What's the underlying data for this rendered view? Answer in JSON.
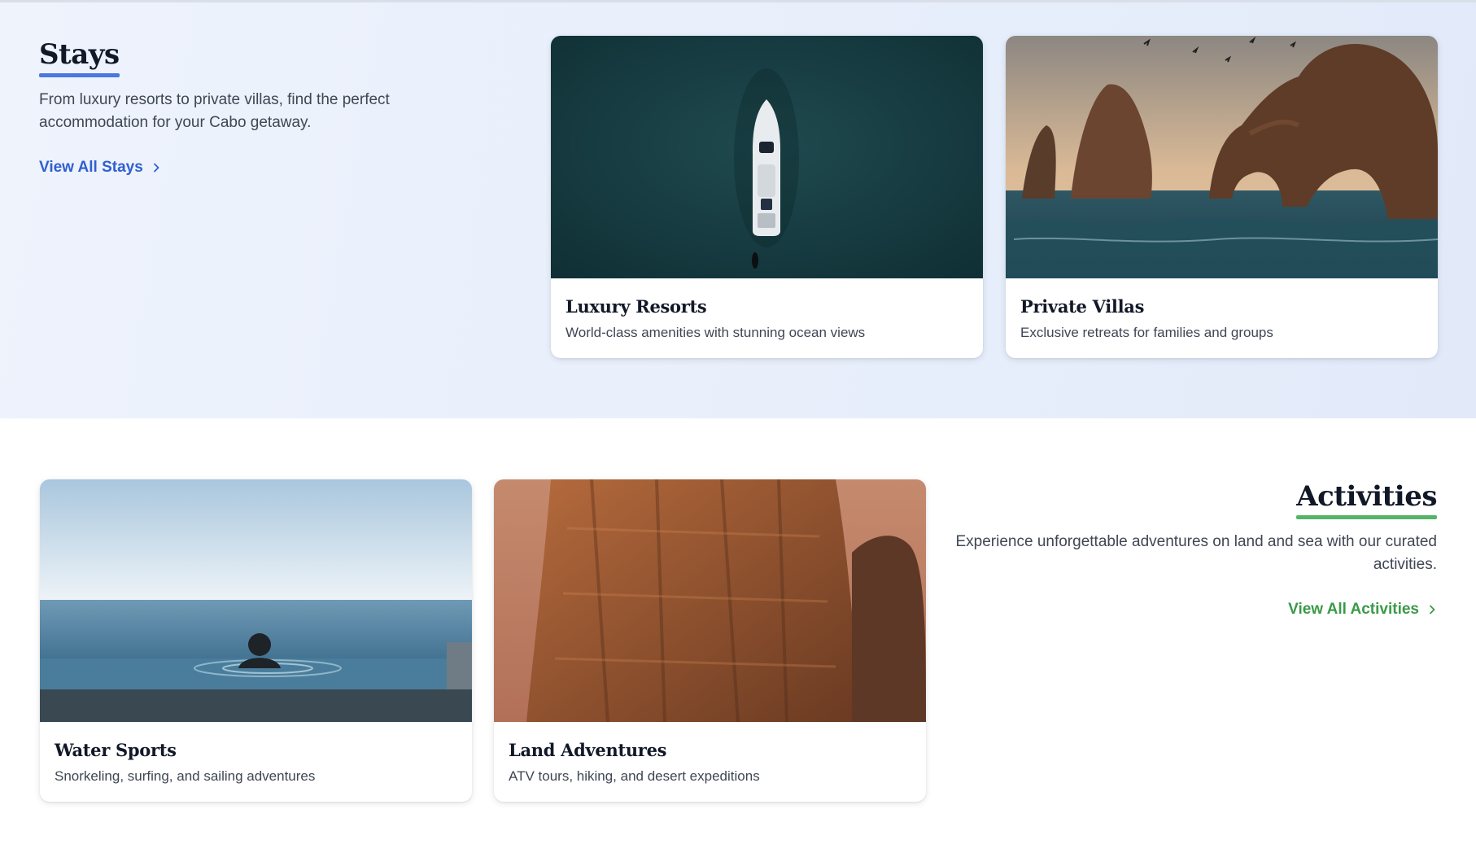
{
  "stays": {
    "title": "Stays",
    "description": "From luxury resorts to private villas, find the perfect accommodation for your Cabo getaway.",
    "link_label": "View All Stays",
    "accent_color": "#4a78e0",
    "cards": [
      {
        "title": "Luxury Resorts",
        "description": "World-class amenities with stunning ocean views",
        "image": "aerial-yacht-on-ocean"
      },
      {
        "title": "Private Villas",
        "description": "Exclusive retreats for families and groups",
        "image": "cabo-arch-rocks-sunset"
      }
    ]
  },
  "activities": {
    "title": "Activities",
    "description": "Experience unforgettable adventures on land and sea with our curated activities.",
    "link_label": "View All Activities",
    "accent_color": "#55b466",
    "cards": [
      {
        "title": "Water Sports",
        "description": "Snorkeling, surfing, and sailing adventures",
        "image": "infinity-pool-ocean-view"
      },
      {
        "title": "Land Adventures",
        "description": "ATV tours, hiking, and desert expeditions",
        "image": "rock-cliffs-sunset"
      }
    ]
  },
  "icons": {
    "link_arrow": "chevron-right-icon"
  }
}
